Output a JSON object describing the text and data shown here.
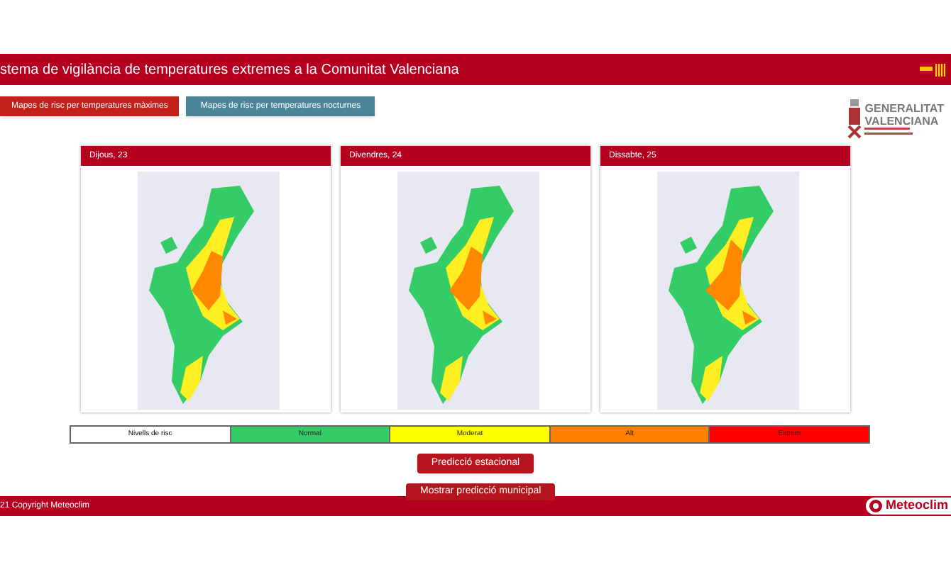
{
  "header": {
    "title": "stema de vigilància de temperatures extremes a la Comunitat Valenciana"
  },
  "tabs": [
    {
      "label": "Mapes de risc per temperatures màximes",
      "selected": true
    },
    {
      "label": "Mapes de risc per temperatures nocturnes",
      "selected": false
    }
  ],
  "logo": {
    "line_1": "GENERALITAT",
    "line_2": "VALENCIANA"
  },
  "maps": [
    {
      "title": "Dijous, 23",
      "kind": "picture"
    },
    {
      "title": "Divendres, 24",
      "kind": "picture"
    },
    {
      "title": "Dissabte, 25",
      "kind": "picture"
    }
  ],
  "legend": {
    "label": "Nivells de risc",
    "levels": [
      {
        "label": "Normal",
        "color": "#33cc66"
      },
      {
        "label": "Moderat",
        "color": "#ffff00"
      },
      {
        "label": "Alt",
        "color": "#ff8000"
      },
      {
        "label": "Extrem",
        "color": "#ff0000"
      }
    ]
  },
  "buttons": [
    "Predicció estacional",
    "Mostrar predicció municipal"
  ],
  "footer": {
    "copyright": "21 Copyright Meteoclim",
    "brand": "Meteoclim"
  }
}
